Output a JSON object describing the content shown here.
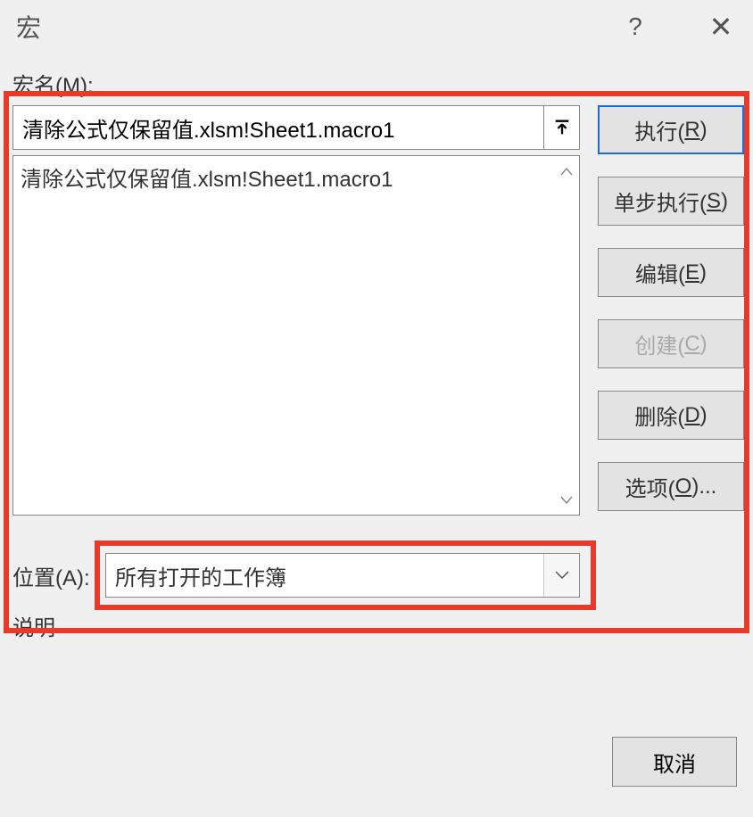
{
  "dialog": {
    "title": "宏",
    "help_icon": "?",
    "close_icon": "✕"
  },
  "labels": {
    "macro_name": "宏名(M):",
    "location": "位置(A):",
    "description": "说明"
  },
  "macro_input": {
    "value": "清除公式仅保留值.xlsm!Sheet1.macro1"
  },
  "macro_list": {
    "items": [
      "清除公式仅保留值.xlsm!Sheet1.macro1"
    ]
  },
  "location_select": {
    "value": "所有打开的工作簿"
  },
  "buttons": {
    "run_prefix": "执行(",
    "run_u": "R",
    "run_suffix": ")",
    "step_prefix": "单步执行(",
    "step_u": "S",
    "step_suffix": ")",
    "edit_prefix": "编辑(",
    "edit_u": "E",
    "edit_suffix": ")",
    "create_prefix": "创建(",
    "create_u": "C",
    "create_suffix": ")",
    "delete_prefix": "删除(",
    "delete_u": "D",
    "delete_suffix": ")",
    "options_prefix": "选项(",
    "options_u": "O",
    "options_suffix": ")...",
    "cancel": "取消"
  }
}
